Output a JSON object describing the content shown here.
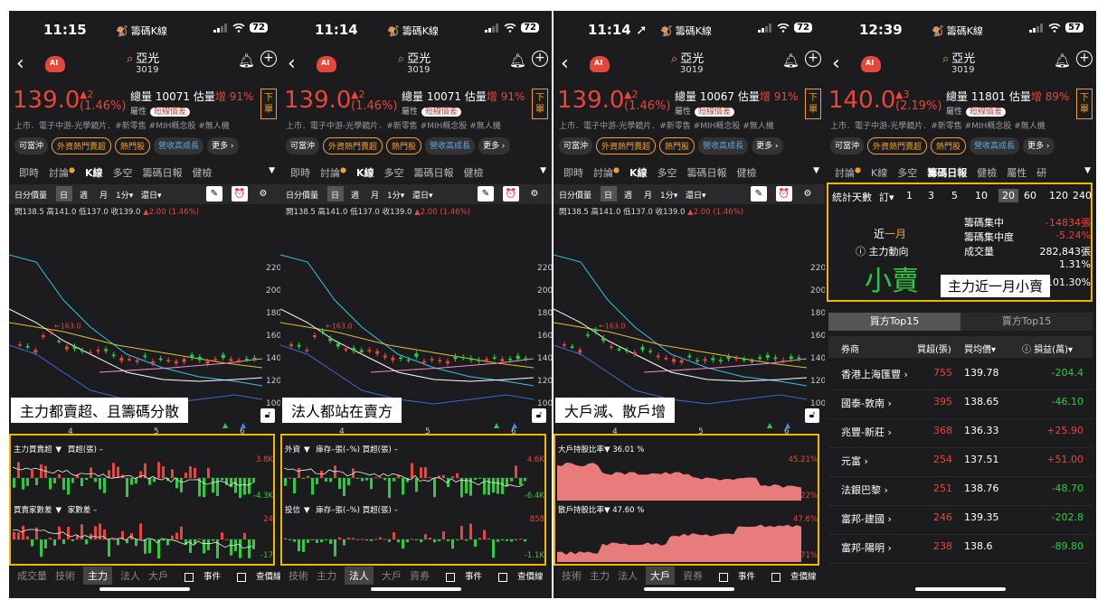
{
  "status": {
    "app_name": "籌碼K線",
    "app_emoji": "🐒",
    "wifi_icon": "wifi-icon",
    "signal_icon": "signal-icon"
  },
  "panels": [
    {
      "time": "11:15",
      "battery": "72",
      "price": "139.0",
      "change": "▲2",
      "change_pct": "(1.46%)",
      "volume": "10071",
      "volume_est_label": "估量",
      "volume_est": "增 91%",
      "bottom_active": "主力",
      "caption": "主力都賣超、且籌碼分散"
    },
    {
      "time": "11:14",
      "battery": "72",
      "price": "139.0",
      "change": "▲2",
      "change_pct": "(1.46%)",
      "volume": "10071",
      "volume_est_label": "估量",
      "volume_est": "增 91%",
      "bottom_active": "法人",
      "caption": "法人都站在賣方"
    },
    {
      "time": "11:14 ➚",
      "battery": "72",
      "price": "139.0",
      "change": "▲2",
      "change_pct": "(1.46%)",
      "volume": "10067",
      "volume_est_label": "估量",
      "volume_est": "增 91%",
      "bottom_active": "大戶",
      "caption": "大戶減、散戶增"
    },
    {
      "time": "12:39",
      "battery": "57",
      "price": "140.0",
      "change": "▲3",
      "change_pct": "(2.19%)",
      "volume": "11801",
      "volume_est_label": "估量",
      "volume_est": "增 89%",
      "bottom_active": "",
      "caption": "主力近一月小賣"
    }
  ],
  "stock": {
    "name": "亞光",
    "code": "3019",
    "volume_label": "總量",
    "attr_label": "屬性",
    "attr_tag": "短線價差",
    "order_button": "下單",
    "sector": "上市．電子中游-光學鏡片．#新零售 #MIH概念股 #無人機",
    "tags": [
      "可當沖",
      "外資熱門賣超",
      "熱門股",
      "營收高成長",
      "更多 ›"
    ]
  },
  "tabs": [
    "即時",
    "討論",
    "K線",
    "多空",
    "籌碼日報",
    "健檢"
  ],
  "tabs_panel4": [
    "討論",
    "K線",
    "多空",
    "籌碼日報",
    "健檢",
    "屬性",
    "研"
  ],
  "chart_toolbar": {
    "indicator": "日分價量",
    "periods": [
      "日",
      "週",
      "月",
      "1分▾",
      "還日▾"
    ],
    "draw_icon": "pen-icon",
    "alarm_icon": "alarm-icon",
    "settings_icon": "gear-icon"
  },
  "ohlc": {
    "text": "開138.5 高141.0 低137.0 收139.0",
    "change": "▲2.00 (1.46%)"
  },
  "chart_data": {
    "type": "line",
    "y_ticks": [
      "220",
      "200",
      "180",
      "160",
      "140",
      "120",
      "100"
    ],
    "x_ticks": [
      "4",
      "5",
      "6"
    ],
    "annotation": "163.0",
    "ylim": [
      100,
      225
    ],
    "close": [
      152,
      150,
      147,
      160,
      163,
      155,
      150,
      148,
      146,
      145,
      147,
      146,
      142,
      140,
      139,
      138,
      141,
      137,
      139,
      138,
      137,
      139,
      140,
      138,
      137,
      139,
      140,
      139,
      138,
      139,
      139
    ]
  },
  "sub_charts": [
    {
      "top_label": "主力買賣超",
      "top_label2": "買超(張) –",
      "top_right": "3.8K",
      "top_right_low": "-4.3K",
      "bottom_label": "買賣家數差",
      "bottom_label2": "家數差 –",
      "bottom_right": "24",
      "bottom_right_low": "-17"
    },
    {
      "top_label": "外資",
      "top_label2": "庫存–張(–%) 買超(張) –",
      "top_right": "4.6K",
      "top_right_low": "-6.4K",
      "bottom_label": "投信",
      "bottom_label2": "庫存–張(–%) 買超(張) –",
      "bottom_right": "858",
      "bottom_right_low": "-1.1K"
    },
    {
      "top_label": "大戶持股比率▼",
      "top_value": "36.01 %",
      "top_right": "45.21%",
      "top_right_low": "35.22%",
      "bottom_label": "散戶持股比率▼",
      "bottom_value": "47.60 %",
      "bottom_right": "47.6%",
      "bottom_right_low": "34.71%"
    }
  ],
  "bottom_tabs": [
    "成交量",
    "技術",
    "主力",
    "法人",
    "大戶",
    "資券"
  ],
  "checkboxes": [
    "事件",
    "查價線"
  ],
  "stats": {
    "days_label": "統計天數",
    "order": "訂▾",
    "days": [
      "1",
      "3",
      "5",
      "10",
      "20",
      "60",
      "120",
      "240"
    ],
    "selected_day": "20",
    "period_prefix": "近",
    "period": "一月",
    "main_dir": "主力動向",
    "verdict": "小賣",
    "lines": [
      {
        "label": "籌碼集中",
        "value": "-14834張"
      },
      {
        "label": "籌碼集中度",
        "value": "-5.24%"
      },
      {
        "label": "成交量",
        "value": "282,843張"
      },
      {
        "label": "",
        "value": "1.31%"
      },
      {
        "label": "籌碼週轉率",
        "value": "101.30%"
      }
    ]
  },
  "table": {
    "tabs": [
      "買方Top15",
      "賣方Top15"
    ],
    "headers": [
      "券商",
      "買超(張)",
      "買均價▾",
      "ⓘ 損益(萬)▾"
    ],
    "rows": [
      {
        "broker": "香港上海匯豐 ›",
        "buy": "755",
        "avg": "139.78",
        "pnl": "-204.4"
      },
      {
        "broker": "國泰-敦南 ›",
        "buy": "395",
        "avg": "138.65",
        "pnl": "-46.10"
      },
      {
        "broker": "兆豐-新莊 ›",
        "buy": "368",
        "avg": "136.33",
        "pnl": "+25.90"
      },
      {
        "broker": "元富 ›",
        "buy": "254",
        "avg": "137.51",
        "pnl": "+51.00"
      },
      {
        "broker": "法銀巴黎 ›",
        "buy": "251",
        "avg": "138.76",
        "pnl": "-48.70"
      },
      {
        "broker": "富邦-建國 ›",
        "buy": "246",
        "avg": "139.35",
        "pnl": "-202.8"
      },
      {
        "broker": "富邦-陽明 ›",
        "buy": "238",
        "avg": "138.6",
        "pnl": "-89.80"
      }
    ]
  },
  "colors": {
    "up": "#e8453c",
    "down": "#2ecc40",
    "accent": "#f0b700",
    "bg": "#1c1c1e"
  }
}
